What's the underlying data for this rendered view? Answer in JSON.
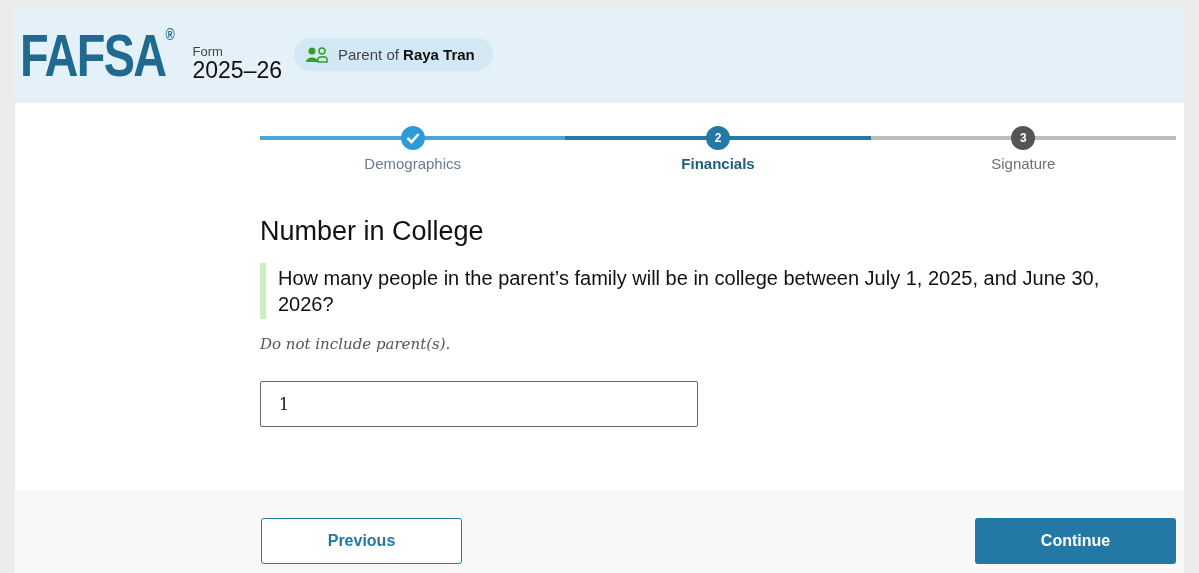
{
  "header": {
    "logo": "FAFSA$^{®}$",
    "form_label": "Form",
    "form_year": "2025–26",
    "role_badge": "Parent of **Raya Tran**"
  },
  "steps": [
    {
      "label": "Demographics",
      "completed": true,
      "selected": false
    },
    {
      "label": "Financials",
      "completed": false,
      "selected": true,
      "number": "2"
    },
    {
      "label": "Signature",
      "completed": false,
      "selected": false,
      "number": "3"
    }
  ],
  "section_title": "Number in College",
  "question": "How many people in the parent’s family will be in college between July 1, 2025, and June 30, 2026?",
  "hint": "Do not include parent(s).",
  "answer": {
    "value": "1"
  },
  "buttons": {
    "previous": "Previous",
    "continue": "Continue"
  }
}
